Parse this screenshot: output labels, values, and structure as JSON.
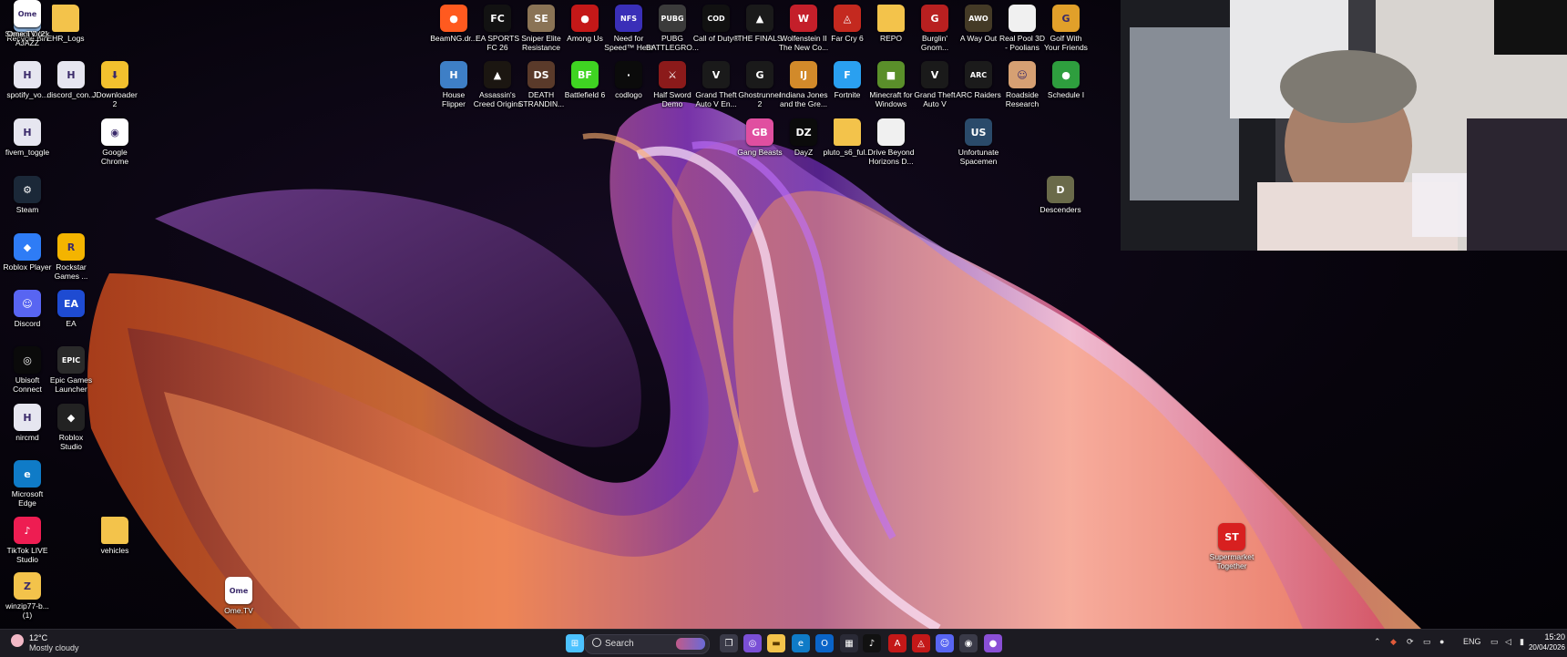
{
  "desktop_icons": [
    {
      "label": "Recycle Bin",
      "color": "#8fb7e3",
      "glyph": "♻"
    },
    {
      "label": "EHR_Logs",
      "color": "#f3c34b",
      "glyph": ""
    },
    {
      "label": "spotify_vo...",
      "color": "#e6e6f0",
      "glyph": "H"
    },
    {
      "label": "discord_con...",
      "color": "#e6e6f0",
      "glyph": "H"
    },
    {
      "label": "JDownloader\n2",
      "color": "#f2c12e",
      "glyph": "⬇"
    },
    {
      "label": "fivem_toggle",
      "color": "#e6e6f0",
      "glyph": "H"
    },
    {
      "label": "Google\nChrome",
      "color": "#ffffff",
      "glyph": "◉"
    },
    {
      "label": "Steam",
      "color": "#1b2838",
      "glyph": "⚙"
    },
    {
      "label": "Roblox Player",
      "color": "#2e7cf6",
      "glyph": "◆"
    },
    {
      "label": "Rockstar\nGames ...",
      "color": "#f4b400",
      "glyph": "R"
    },
    {
      "label": "Discord",
      "color": "#5865f2",
      "glyph": "☺"
    },
    {
      "label": "EA",
      "color": "#1e4bd2",
      "glyph": "EA"
    },
    {
      "label": "Ubisoft\nConnect",
      "color": "#0a0a0a",
      "glyph": "◎"
    },
    {
      "label": "Epic Games\nLauncher",
      "color": "#2a2a2a",
      "glyph": "EPIC"
    },
    {
      "label": "nircmd",
      "color": "#e6e6f0",
      "glyph": "H"
    },
    {
      "label": "Roblox\nStudio",
      "color": "#222222",
      "glyph": "◆"
    },
    {
      "label": "Microsoft\nEdge",
      "color": "#0f7bc7",
      "glyph": "e"
    },
    {
      "label": "TikTok LIVE\nStudio",
      "color": "#ee1d52",
      "glyph": "♪"
    },
    {
      "label": "vehicles",
      "color": "#f3c34b",
      "glyph": ""
    },
    {
      "label": "winzip77-b...\n(1)",
      "color": "#f3c34b",
      "glyph": "Z"
    },
    {
      "label": "Ome.TV",
      "color": "#ffffff",
      "glyph": "Ome"
    },
    {
      "label": "BeamNG.dr...",
      "color": "#ff5a1f",
      "glyph": "●"
    },
    {
      "label": "EA SPORTS\nFC 26",
      "color": "#121212",
      "glyph": "FC"
    },
    {
      "label": "Sniper Elite\nResistance",
      "color": "#8a7355",
      "glyph": "SE"
    },
    {
      "label": "Among Us",
      "color": "#c41818",
      "glyph": "●"
    },
    {
      "label": "Need for\nSpeed™ Heat",
      "color": "#3a2fb8",
      "glyph": "NFS"
    },
    {
      "label": "PUBG\nBATTLEGRO...",
      "color": "#3b3b3b",
      "glyph": "PUBG"
    },
    {
      "label": "Call of Duty®",
      "color": "#111111",
      "glyph": "COD"
    },
    {
      "label": "THE FINALS",
      "color": "#1a1a1a",
      "glyph": "▲"
    },
    {
      "label": "Wolfenstein II\nThe New Co...",
      "color": "#c41f2a",
      "glyph": "W"
    },
    {
      "label": "Far Cry 6",
      "color": "#c4291f",
      "glyph": "◬"
    },
    {
      "label": "REPO",
      "color": "#f3c34b",
      "glyph": ""
    },
    {
      "label": "Burglin'\nGnom...",
      "color": "#b82020",
      "glyph": "G"
    },
    {
      "label": "A Way Out",
      "color": "#443a26",
      "glyph": "AWO"
    },
    {
      "label": "Real Pool 3D\n- Poolians",
      "color": "#f0f0f0",
      "glyph": ""
    },
    {
      "label": "Golf With\nYour Friends",
      "color": "#e1a02a",
      "glyph": "G"
    },
    {
      "label": "House\nFlipper",
      "color": "#3e7fc6",
      "glyph": "H"
    },
    {
      "label": "Assassin's\nCreed Origins",
      "color": "#1b1611",
      "glyph": "▲"
    },
    {
      "label": "DEATH\nSTRANDIN...",
      "color": "#5a3a2a",
      "glyph": "DS"
    },
    {
      "label": "Battlefield 6",
      "color": "#3fd422",
      "glyph": "BF"
    },
    {
      "label": "codlogo",
      "color": "#0b0b0b",
      "glyph": "·"
    },
    {
      "label": "Half Sword\nDemo",
      "color": "#8b1a1a",
      "glyph": "⚔"
    },
    {
      "label": "Grand Theft\nAuto V En...",
      "color": "#1a1a1a",
      "glyph": "V"
    },
    {
      "label": "Ghostrunner\n2",
      "color": "#1a1a1a",
      "glyph": "G"
    },
    {
      "label": "Indiana Jones\nand the Gre...",
      "color": "#d28a2a",
      "glyph": "IJ"
    },
    {
      "label": "Fortnite",
      "color": "#2aa0f0",
      "glyph": "F"
    },
    {
      "label": "Minecraft for\nWindows",
      "color": "#5a8f2a",
      "glyph": "■"
    },
    {
      "label": "Grand Theft\nAuto V",
      "color": "#1a1a1a",
      "glyph": "V"
    },
    {
      "label": "ARC Raiders",
      "color": "#1b1b1b",
      "glyph": "ARC"
    },
    {
      "label": "Roadside\nResearch",
      "color": "#d6a073",
      "glyph": "☺"
    },
    {
      "label": "Schedule I",
      "color": "#2e9e3e",
      "glyph": "●"
    },
    {
      "label": "Gang Beasts",
      "color": "#e04fa0",
      "glyph": "GB"
    },
    {
      "label": "DayZ",
      "color": "#0b0b0b",
      "glyph": "DZ"
    },
    {
      "label": "pluto_s6_ful...",
      "color": "#f3c34b",
      "glyph": ""
    },
    {
      "label": "Drive Beyond\nHorizons D...",
      "color": "#f0f0f0",
      "glyph": ""
    },
    {
      "label": "Unfortunate\nSpacemen",
      "color": "#2a4a6a",
      "glyph": "US"
    },
    {
      "label": "Descenders",
      "color": "#6a6a4a",
      "glyph": "D"
    },
    {
      "label": "Supermarket\nTogether",
      "color": "#d82020",
      "glyph": "ST"
    },
    {
      "label": "Stream Dock\nAJAZZ",
      "color": "#0b0b0b",
      "glyph": "◬"
    },
    {
      "label": "Ome.TV (2)",
      "color": "#ffffff",
      "glyph": "Ome"
    }
  ],
  "taskbar": {
    "weather_temp": "12°C",
    "weather_desc": "Mostly cloudy",
    "search_placeholder": "Search",
    "apps": [
      {
        "name": "start-button",
        "glyph": "⊞",
        "color": "#4cc2ff"
      },
      {
        "name": "search",
        "glyph": "",
        "color": ""
      },
      {
        "name": "widgets-app",
        "glyph": "◐",
        "color": "#2a2a3a"
      },
      {
        "name": "task-view",
        "glyph": "❐",
        "color": "#3a3a48"
      },
      {
        "name": "copilot",
        "glyph": "◎",
        "color": "#7a4fd6"
      },
      {
        "name": "file-explorer",
        "glyph": "▬",
        "color": "#f3c34b"
      },
      {
        "name": "edge",
        "glyph": "e",
        "color": "#0f7bc7"
      },
      {
        "name": "outlook",
        "glyph": "O",
        "color": "#0a64c8"
      },
      {
        "name": "store",
        "glyph": "▦",
        "color": "#2a2a36"
      },
      {
        "name": "tiktok",
        "glyph": "♪",
        "color": "#111111"
      },
      {
        "name": "adobe-app",
        "glyph": "A",
        "color": "#c41818"
      },
      {
        "name": "stream-dock",
        "glyph": "◬",
        "color": "#c41818"
      },
      {
        "name": "discord",
        "glyph": "☺",
        "color": "#5865f2"
      },
      {
        "name": "chrome-like",
        "glyph": "◉",
        "color": "#3a3a48"
      },
      {
        "name": "obs-like",
        "glyph": "●",
        "color": "#8a4fd6"
      }
    ],
    "language": "ENG",
    "time": "15:20",
    "date": "20/04/2026"
  }
}
